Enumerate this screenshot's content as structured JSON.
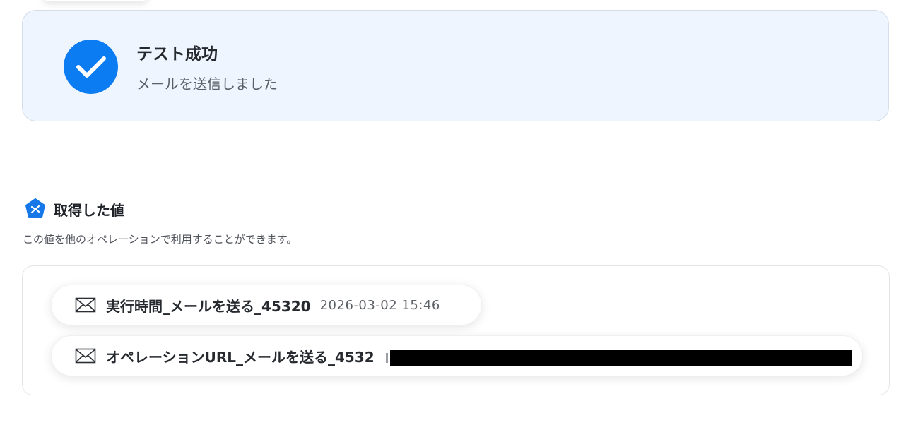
{
  "success": {
    "title": "テスト成功",
    "subtitle": "メールを送信しました",
    "icon": "check-icon",
    "accent_color": "#0c7cf2"
  },
  "acquired": {
    "title": "取得した値",
    "description": "この値を他のオペレーションで利用することができます。",
    "icon": "yoom-pentagon-icon"
  },
  "values": [
    {
      "icon": "mail-icon",
      "label": "実行時間_メールを送る_45320",
      "value": "2026-03-02 15:46"
    },
    {
      "icon": "mail-icon",
      "label": "オペレーションURL_メールを送る_4532",
      "value": ""
    }
  ]
}
